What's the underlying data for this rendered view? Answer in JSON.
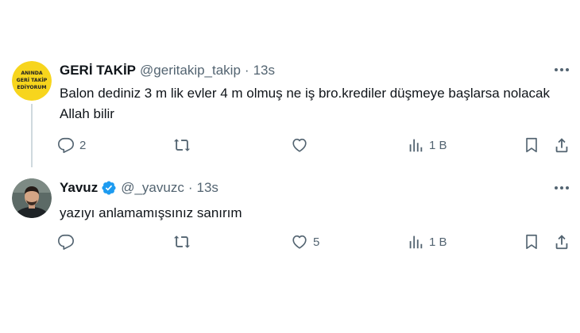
{
  "tweets": [
    {
      "name": "GERİ TAKİP",
      "handle": "@geritakip_takip",
      "separator": "·",
      "time": "13s",
      "verified": false,
      "avatar_text": [
        "ANINDA",
        "GERİ TAKİP",
        "EDİYORUM"
      ],
      "text": "Balon dediniz 3 m lik evler 4 m olmuş ne iş bro.krediler düşmeye başlarsa nolacak Allah bilir",
      "stats": {
        "replies": "2",
        "retweets": "",
        "likes": "",
        "views": "1 B"
      }
    },
    {
      "name": "Yavuz",
      "handle": "@_yavuzc",
      "separator": "·",
      "time": "13s",
      "verified": true,
      "text": "yazıyı anlamamışsınız sanırım",
      "stats": {
        "replies": "",
        "retweets": "",
        "likes": "5",
        "views": "1 B"
      }
    }
  ],
  "colors": {
    "text_primary": "#0f1419",
    "text_secondary": "#536471",
    "verified_blue": "#1d9bf0",
    "avatar_yellow": "#f7d51d",
    "thread_line": "#cfd9de"
  },
  "icons": [
    "reply-icon",
    "retweet-icon",
    "like-icon",
    "views-icon",
    "bookmark-icon",
    "share-icon",
    "more-icon",
    "verified-icon"
  ]
}
